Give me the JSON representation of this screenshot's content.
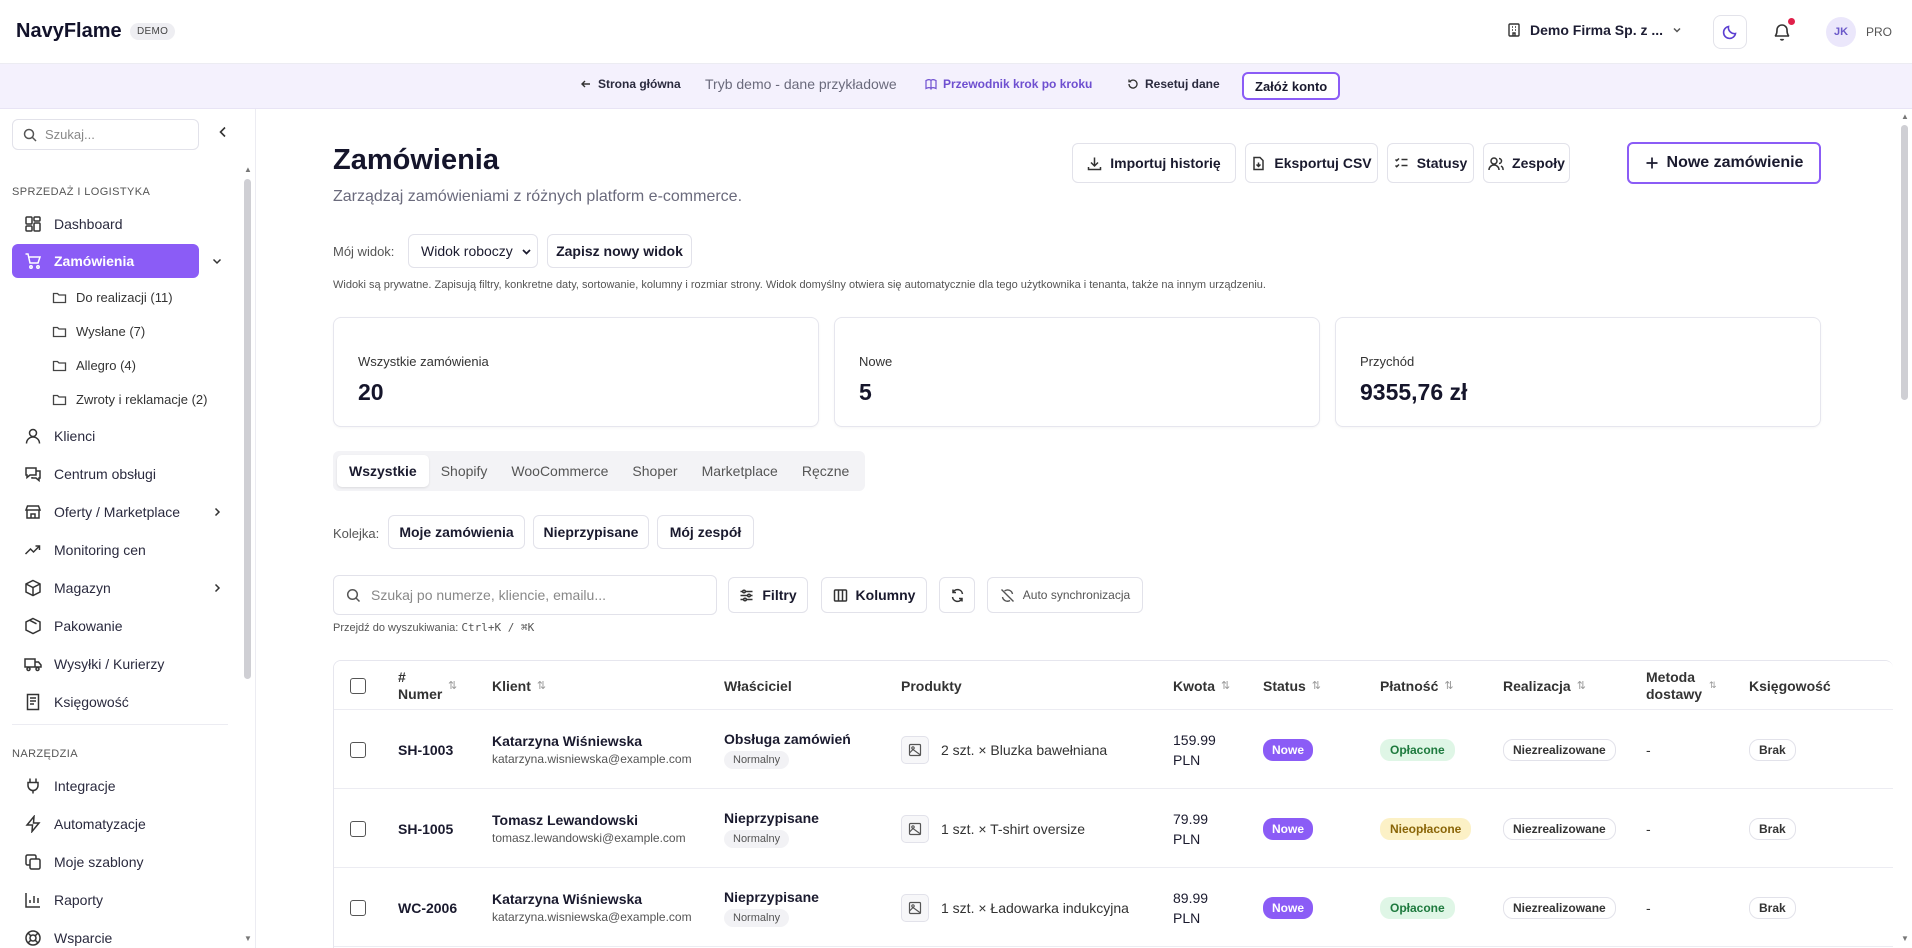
{
  "header": {
    "brand": "NavyFlame",
    "badge": "DEMO",
    "company": "Demo Firma Sp. z ...",
    "avatar_initials": "JK",
    "plan": "PRO"
  },
  "banner": {
    "home": "Strona główna",
    "mode": "Tryb demo - dane przykładowe",
    "guide": "Przewodnik krok po kroku",
    "reset": "Resetuj dane",
    "create_account": "Załóż konto"
  },
  "sidebar": {
    "search_placeholder": "Szukaj...",
    "section_sales": "SPRZEDAŻ I LOGISTYKA",
    "section_tools": "NARZĘDZIA",
    "items": [
      {
        "label": "Dashboard",
        "icon": "dashboard-icon"
      },
      {
        "label": "Zamówienia",
        "icon": "cart-icon"
      },
      {
        "label": "Klienci",
        "icon": "user-icon"
      },
      {
        "label": "Centrum obsługi",
        "icon": "chat-icon"
      },
      {
        "label": "Oferty / Marketplace",
        "icon": "store-icon"
      },
      {
        "label": "Monitoring cen",
        "icon": "trend-icon"
      },
      {
        "label": "Magazyn",
        "icon": "box-icon"
      },
      {
        "label": "Pakowanie",
        "icon": "package-icon"
      },
      {
        "label": "Wysyłki / Kurierzy",
        "icon": "truck-icon"
      },
      {
        "label": "Księgowość",
        "icon": "receipt-icon"
      }
    ],
    "sub_items": [
      "Do realizacji (11)",
      "Wysłane (7)",
      "Allegro (4)",
      "Zwroty i reklamacje (2)"
    ],
    "tools": [
      {
        "label": "Integracje",
        "icon": "plug-icon"
      },
      {
        "label": "Automatyzacje",
        "icon": "zap-icon"
      },
      {
        "label": "Moje szablony",
        "icon": "copy-icon"
      },
      {
        "label": "Raporty",
        "icon": "chart-icon"
      },
      {
        "label": "Wsparcie",
        "icon": "lifebuoy-icon"
      }
    ]
  },
  "page": {
    "title": "Zamówienia",
    "subtitle": "Zarządzaj zamówieniami z różnych platform e-commerce.",
    "actions": {
      "import": "Importuj historię",
      "export": "Eksportuj CSV",
      "statuses": "Statusy",
      "teams": "Zespoły",
      "new_order": "Nowe zamówienie"
    },
    "view": {
      "label": "Mój widok:",
      "selected": "Widok roboczy",
      "save": "Zapisz nowy widok",
      "hint": "Widoki są prywatne. Zapisują filtry, konkretne daty, sortowanie, kolumny i rozmiar strony. Widok domyślny otwiera się automatycznie dla tego użytkownika i tenanta, także na innym urządzeniu."
    },
    "stats": [
      {
        "label": "Wszystkie zamówienia",
        "value": "20"
      },
      {
        "label": "Nowe",
        "value": "5"
      },
      {
        "label": "Przychód",
        "value": "9355,76 zł"
      }
    ],
    "tabs": [
      "Wszystkie",
      "Shopify",
      "WooCommerce",
      "Shoper",
      "Marketplace",
      "Ręczne"
    ],
    "queue": {
      "label": "Kolejka:",
      "mine": "Moje zamówienia",
      "unassigned": "Nieprzypisane",
      "team": "Mój zespół"
    },
    "toolbar": {
      "search_placeholder": "Szukaj po numerze, kliencie, emailu...",
      "filters": "Filtry",
      "columns": "Kolumny",
      "auto_sync": "Auto synchronizacja",
      "shortcut_label": "Przejdź do wyszukiwania:",
      "shortcut_keys": "Ctrl+K / ⌘K"
    }
  },
  "table": {
    "headers": {
      "hash": "#",
      "number": "Numer",
      "client": "Klient",
      "owner": "Właściciel",
      "products": "Produkty",
      "amount": "Kwota",
      "status": "Status",
      "payment": "Płatność",
      "fulfillment": "Realizacja",
      "delivery_1": "Metoda",
      "delivery_2": "dostawy",
      "accounting": "Księgowość"
    },
    "rows": [
      {
        "number": "SH-1003",
        "client": "Katarzyna Wiśniewska",
        "email": "katarzyna.wisniewska@example.com",
        "owner": "Obsługa zamówień",
        "priority": "Normalny",
        "product": "2 szt. × Bluzka bawełniana",
        "amount_value": "159.99",
        "currency": "PLN",
        "status": "Nowe",
        "payment": "Opłacone",
        "payment_state": "paid",
        "fulfillment": "Niezrealizowane",
        "delivery": "-",
        "accounting": "Brak"
      },
      {
        "number": "SH-1005",
        "client": "Tomasz Lewandowski",
        "email": "tomasz.lewandowski@example.com",
        "owner": "Nieprzypisane",
        "priority": "Normalny",
        "product": "1 szt. × T-shirt oversize",
        "amount_value": "79.99",
        "currency": "PLN",
        "status": "Nowe",
        "payment": "Nieopłacone",
        "payment_state": "unpaid",
        "fulfillment": "Niezrealizowane",
        "delivery": "-",
        "accounting": "Brak"
      },
      {
        "number": "WC-2006",
        "client": "Katarzyna Wiśniewska",
        "email": "katarzyna.wisniewska@example.com",
        "owner": "Nieprzypisane",
        "priority": "Normalny",
        "product": "1 szt. × Ładowarka indukcyjna",
        "amount_value": "89.99",
        "currency": "PLN",
        "status": "Nowe",
        "payment": "Opłacone",
        "payment_state": "paid",
        "fulfillment": "Niezrealizowane",
        "delivery": "-",
        "accounting": "Brak"
      }
    ]
  },
  "colors": {
    "accent": "#8b5cf6",
    "paid_bg": "#dff6e6",
    "unpaid_bg": "#fcf1c6"
  }
}
